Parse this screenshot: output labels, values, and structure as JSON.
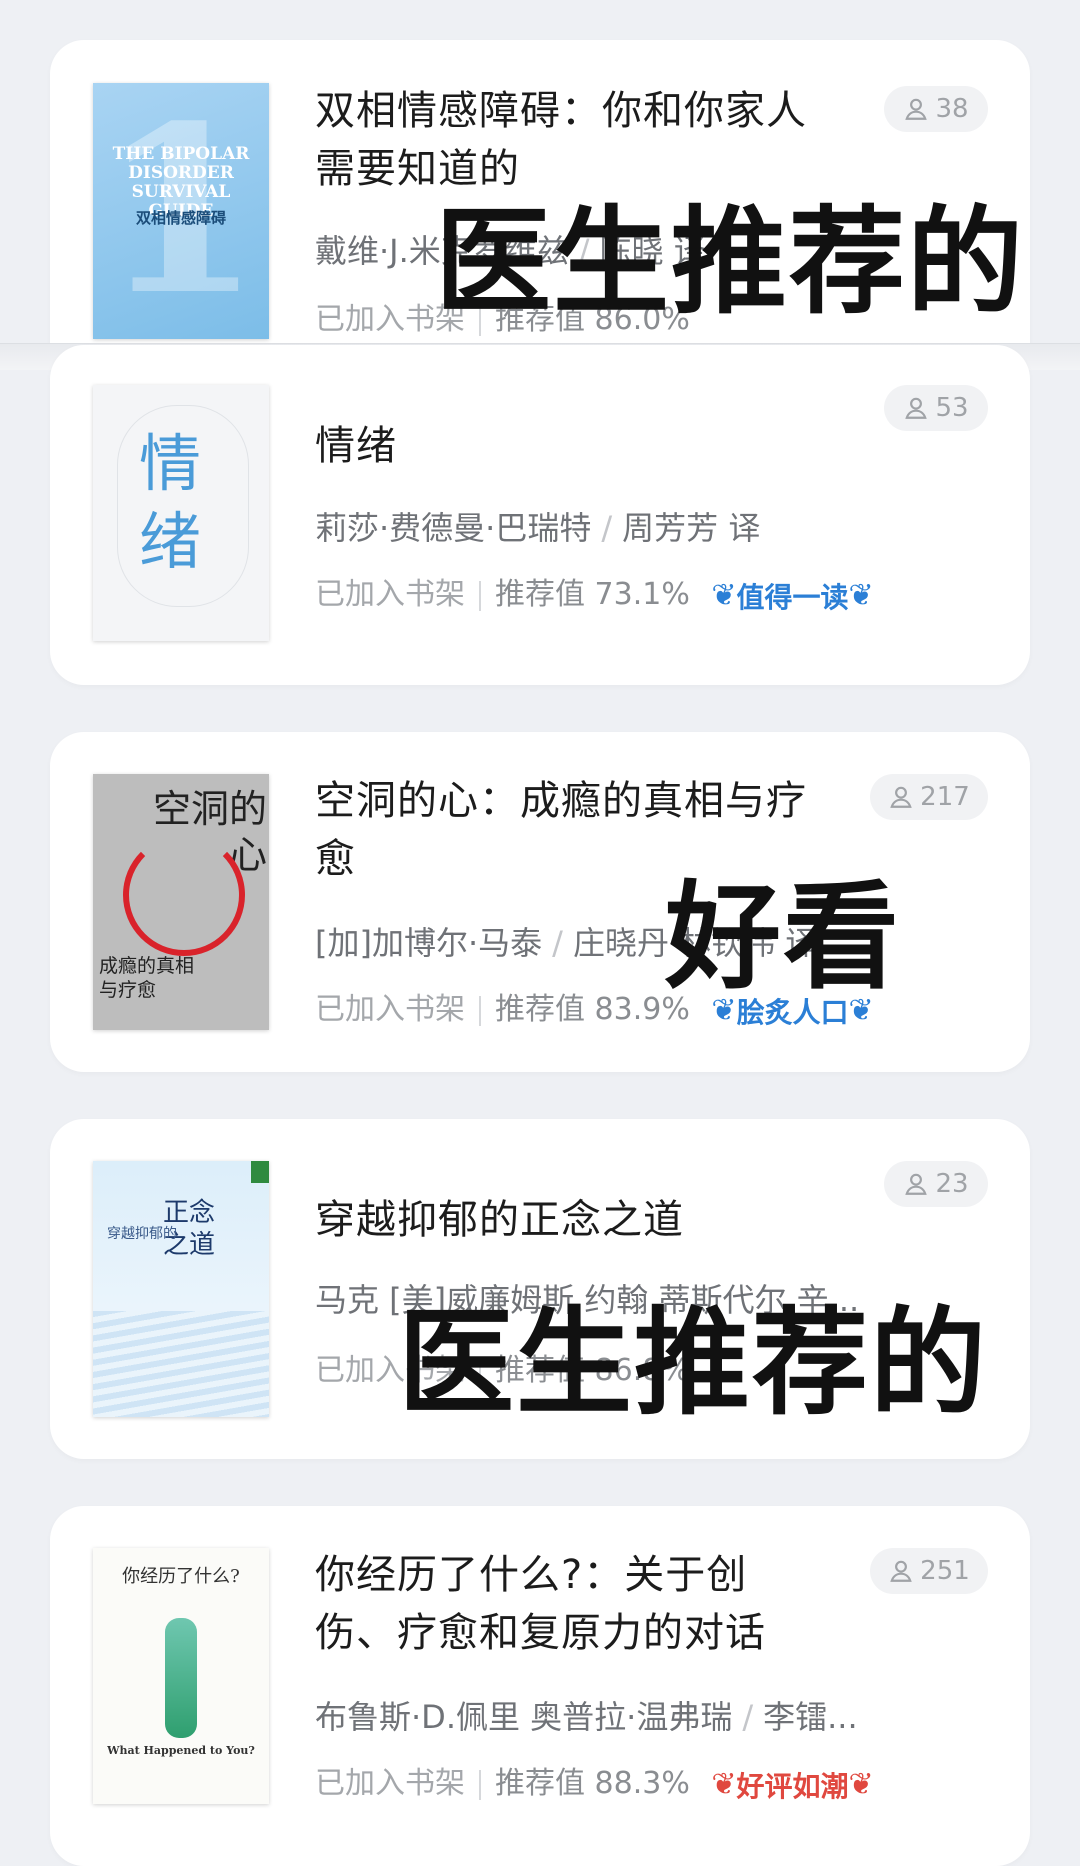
{
  "books": [
    {
      "title": "双相情感障碍：你和你家人需要知道的",
      "author1": "戴维·J.米克罗维兹",
      "author2": "陈晓 译",
      "shelf": "已加入书架",
      "rating": "推荐值 86.0%",
      "badge": "",
      "readers": "38",
      "cover_text": "THE BIPOLAR DISORDER SURVIVAL GUIDE",
      "cover_cn": "双相情感障碍"
    },
    {
      "title": "情绪",
      "author1": "莉莎·费德曼·巴瑞特",
      "author2": "周芳芳 译",
      "shelf": "已加入书架",
      "rating": "推荐值 73.1%",
      "badge": "值得一读",
      "readers": "53",
      "cover_text": "情绪",
      "cover_cn": "情绪"
    },
    {
      "title": "空洞的心：成瘾的真相与疗愈",
      "author1": "[加]加博尔·马泰",
      "author2": "庄晓丹 林钦伟 译",
      "shelf": "已加入书架",
      "rating": "推荐值 83.9%",
      "badge": "脍炙人口",
      "readers": "217",
      "cover_text": "空洞的心",
      "cover_cn": "成瘾的真相与疗愈"
    },
    {
      "title": "穿越抑郁的正念之道",
      "author1": "马克 [美]威廉姆斯 约翰 蒂斯代尔 辛...",
      "author2": "",
      "shelf": "已加入书架",
      "rating": "推荐值 86.8%",
      "badge": "",
      "readers": "23",
      "cover_text": "正念之道",
      "cover_cn": "穿越抑郁的"
    },
    {
      "title": "你经历了什么?：关于创伤、疗愈和复原力的对话",
      "author1": "布鲁斯·D.佩里 奥普拉·温弗瑞",
      "author2": "李镭...",
      "shelf": "已加入书架",
      "rating": "推荐值 88.3%",
      "badge": "好评如潮",
      "readers": "251",
      "cover_text": "What Happened to You?",
      "cover_cn": "你经历了什么?"
    }
  ],
  "overlays": {
    "doctor1": "医生推荐的",
    "good": "好看",
    "doctor2": "医生推荐的"
  },
  "colors": {
    "badge_blue": "#2b7fd6",
    "badge_red": "#e0483f",
    "bg": "#eef0f4"
  }
}
